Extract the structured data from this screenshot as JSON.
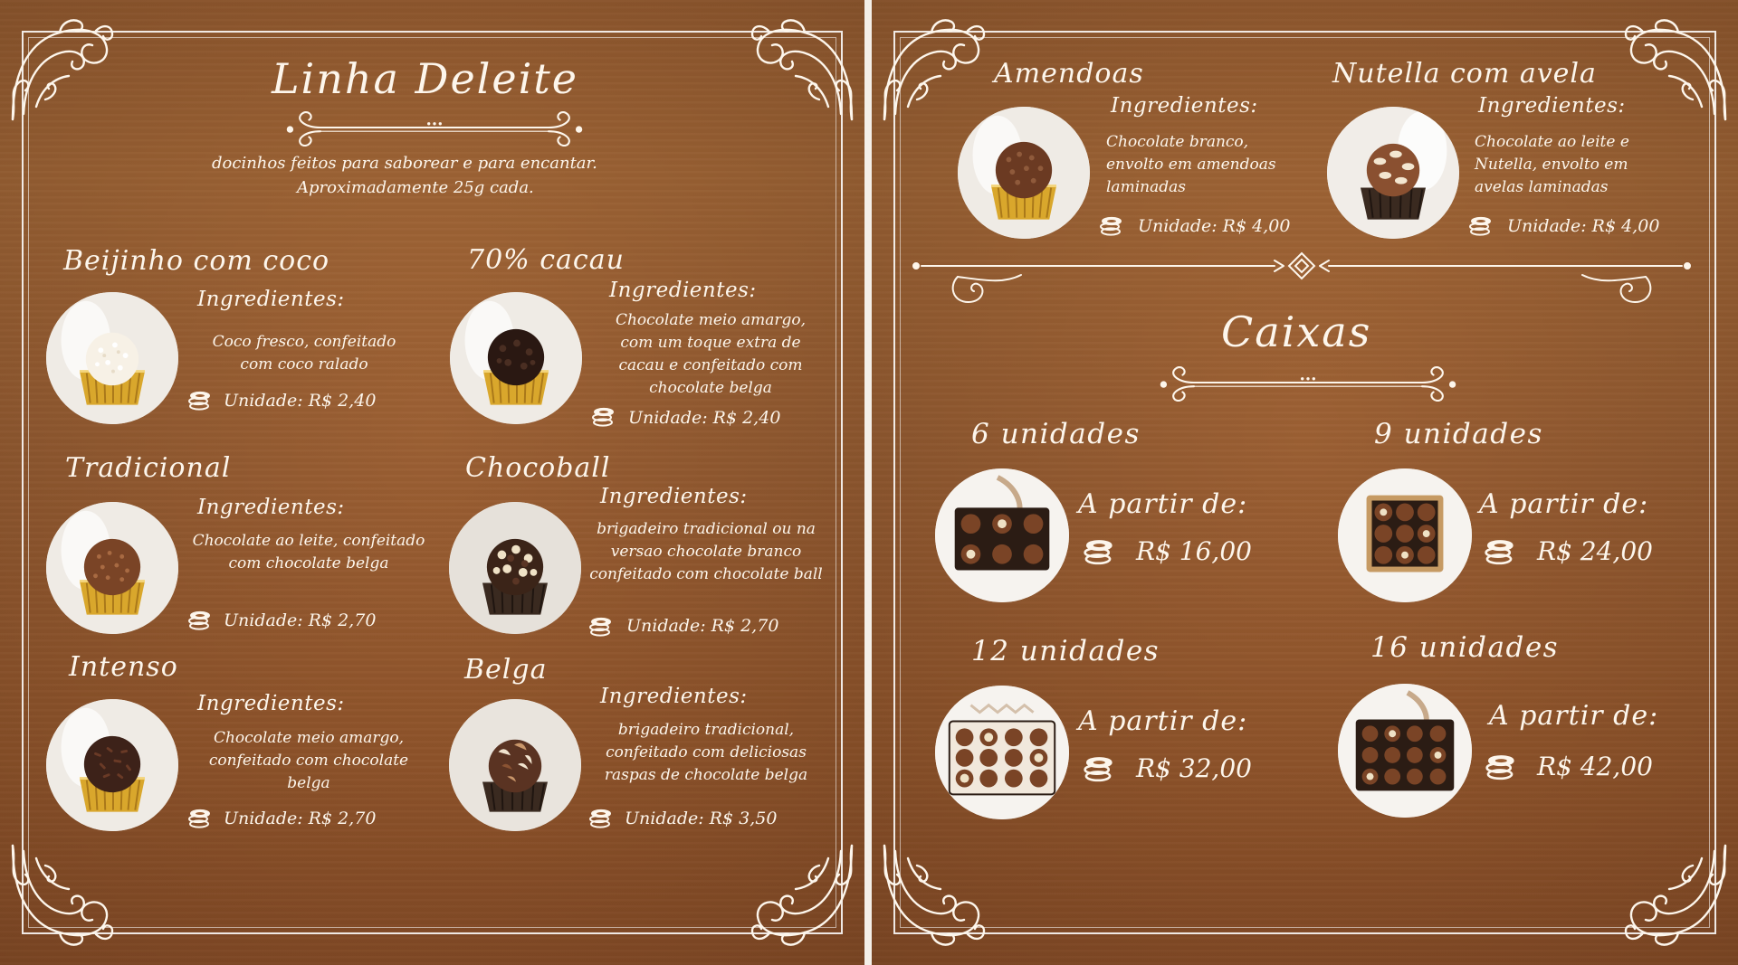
{
  "left_page": {
    "title": "Linha Deleite",
    "subtitle_line1": "docinhos feitos para saborear e para encantar.",
    "subtitle_line2": "Aproximadamente 25g cada.",
    "products": [
      {
        "name": "Beijinho com coco",
        "ingredients_label": "Ingredientes:",
        "description": "Coco fresco, confeitado com coco ralado",
        "price": "Unidade: R$ 2,40",
        "topping": "coconut"
      },
      {
        "name": "70% cacau",
        "ingredients_label": "Ingredientes:",
        "description": "Chocolate meio amargo, com um toque extra de cacau e confeitado com chocolate belga",
        "price": "Unidade: R$ 2,40",
        "topping": "dark-chips"
      },
      {
        "name": "Tradicional",
        "ingredients_label": "Ingredientes:",
        "description": "Chocolate ao leite, confeitado com chocolate belga",
        "price": "Unidade: R$ 2,70",
        "topping": "milk-sprinkles"
      },
      {
        "name": "Chocoball",
        "ingredients_label": "Ingredientes:",
        "description": "brigadeiro tradicional ou na versao chocolate branco confeitado com chocolate ball",
        "price": "Unidade: R$ 2,70",
        "topping": "balls"
      },
      {
        "name": "Intenso",
        "ingredients_label": "Ingredientes:",
        "description": "Chocolate meio amargo, confeitado com chocolate belga",
        "price": "Unidade: R$ 2,70",
        "topping": "dark-sprinkles"
      },
      {
        "name": "Belga",
        "ingredients_label": "Ingredientes:",
        "description": "brigadeiro tradicional, confeitado com deliciosas raspas de chocolate belga",
        "price": "Unidade: R$ 3,50",
        "topping": "shavings"
      }
    ]
  },
  "right_page": {
    "products": [
      {
        "name": "Amendoas",
        "ingredients_label": "Ingredientes:",
        "description": "Chocolate branco, envolto em amendoas laminadas",
        "price": "Unidade: R$ 4,00"
      },
      {
        "name": "Nutella com avela",
        "ingredients_label": "Ingredientes:",
        "description": "Chocolate ao leite e Nutella, envolto em avelas laminadas",
        "price": "Unidade: R$ 4,00"
      }
    ],
    "boxes_title": "Caixas",
    "boxes": [
      {
        "name": "6 unidades",
        "from_label": "A partir de:",
        "price": "R$ 16,00"
      },
      {
        "name": "9 unidades",
        "from_label": "A partir de:",
        "price": "R$ 24,00"
      },
      {
        "name": "12 unidades",
        "from_label": "A partir de:",
        "price": "R$ 32,00"
      },
      {
        "name": "16 unidades",
        "from_label": "A partir de:",
        "price": "R$ 42,00"
      }
    ]
  },
  "colors": {
    "wood": "#9b5f33",
    "ink": "#fdf6ec",
    "gold_cup": "#d9a72c",
    "dark_cup": "#3a2a20"
  },
  "icons": [
    "coin-stack-icon",
    "corner-flourish-icon",
    "ornament-divider-icon"
  ]
}
